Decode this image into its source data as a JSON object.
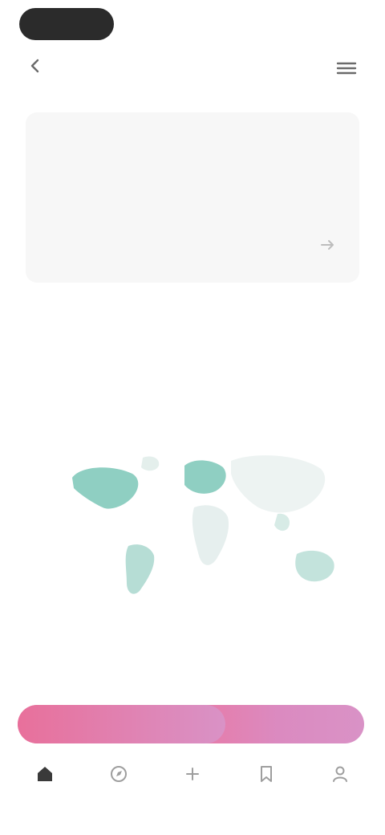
{
  "app": {
    "title": ""
  },
  "icons": {
    "back": "back-icon",
    "menu": "menu-icon",
    "card_action": "share-icon"
  },
  "card": {
    "eyebrow": "",
    "title": "",
    "meta": "",
    "action_icon": "share-icon"
  },
  "map": {
    "title": "",
    "subtitle": "",
    "colors": {
      "land": "#a9d8cf",
      "accent": "#6fbfb1",
      "muted": "#e6e6e6"
    }
  },
  "section": {
    "label": "",
    "link": ""
  },
  "progress": {
    "fraction": 0.6,
    "colors": {
      "start": "#e8709b",
      "end": "#d992c6"
    }
  },
  "nav": {
    "items": [
      {
        "icon": "home-icon",
        "label": ""
      },
      {
        "icon": "explore-icon",
        "label": ""
      },
      {
        "icon": "add-icon",
        "label": ""
      },
      {
        "icon": "bookmark-icon",
        "label": ""
      },
      {
        "icon": "profile-icon",
        "label": ""
      }
    ]
  }
}
